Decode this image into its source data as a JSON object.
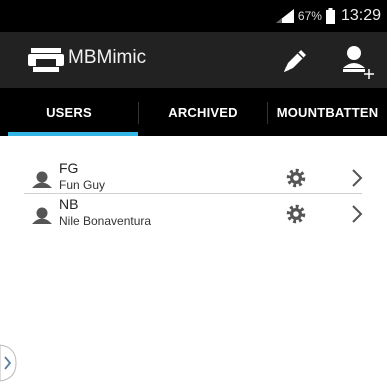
{
  "status_bar": {
    "battery_percent": "67%",
    "time": "13:29",
    "icons": [
      "signal-icon",
      "battery-icon"
    ]
  },
  "action_bar": {
    "app_icon": "printer-icon",
    "title": "MBMimic",
    "actions": [
      "pencil-icon",
      "add-user-icon"
    ]
  },
  "tabs": [
    {
      "label": "USERS",
      "selected": true
    },
    {
      "label": "ARCHIVED",
      "selected": false
    },
    {
      "label": "MOUNTBATTEN",
      "selected": false
    }
  ],
  "users": [
    {
      "abbr": "FG",
      "name": "Fun Guy",
      "icons": [
        "person-icon",
        "gear-icon",
        "chevron-right-icon"
      ]
    },
    {
      "abbr": "NB",
      "name": "Nile Bonaventura",
      "icons": [
        "person-icon",
        "gear-icon",
        "chevron-right-icon"
      ]
    }
  ],
  "drawer_handle_icon": "chevron-right-icon",
  "colors": {
    "status_bar_bg": "#000000",
    "action_bar_bg": "#222222",
    "tab_bar_bg": "#000000",
    "tab_indicator": "#33b5e5",
    "list_bg": "#ffffff",
    "icon_gray": "#555555"
  }
}
